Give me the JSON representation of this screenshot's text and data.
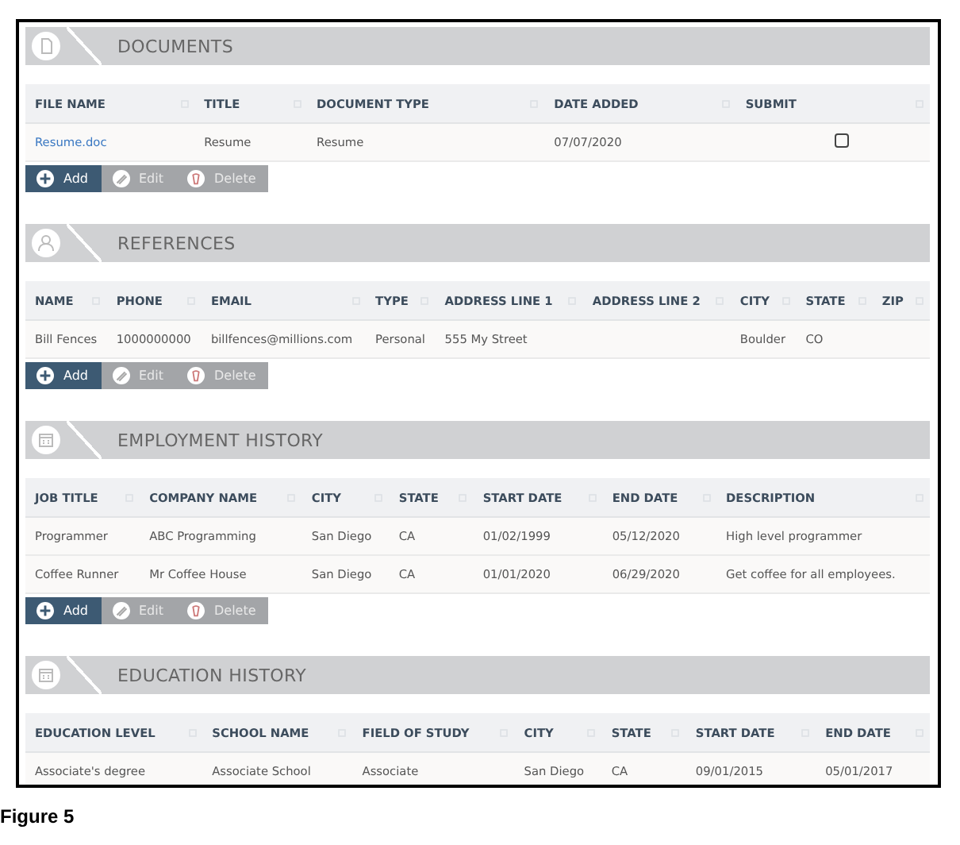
{
  "sections": [
    {
      "title": "DOCUMENTS",
      "columns": [
        "FILE NAME",
        "TITLE",
        "DOCUMENT TYPE",
        "DATE ADDED",
        "SUBMIT"
      ],
      "rows": [
        [
          {
            "kind": "link",
            "text": "Resume.doc"
          },
          {
            "kind": "text",
            "text": "Resume"
          },
          {
            "kind": "text",
            "text": "Resume"
          },
          {
            "kind": "text",
            "text": "07/07/2020"
          },
          {
            "kind": "checkbox",
            "checked": false
          }
        ]
      ],
      "buttons": [
        {
          "label": "Add",
          "disabled": false
        },
        {
          "label": "Edit",
          "disabled": true
        },
        {
          "label": "Delete",
          "disabled": true
        }
      ]
    },
    {
      "title": "REFERENCES",
      "columns": [
        "NAME",
        "PHONE",
        "EMAIL",
        "TYPE",
        "ADDRESS LINE 1",
        "ADDRESS LINE 2",
        "CITY",
        "STATE",
        "ZIP"
      ],
      "rows": [
        [
          {
            "kind": "text",
            "text": "Bill Fences"
          },
          {
            "kind": "text",
            "text": "1000000000"
          },
          {
            "kind": "text",
            "text": "billfences@millions.com"
          },
          {
            "kind": "text",
            "text": "Personal"
          },
          {
            "kind": "text",
            "text": "555 My Street"
          },
          {
            "kind": "text",
            "text": ""
          },
          {
            "kind": "text",
            "text": "Boulder"
          },
          {
            "kind": "text",
            "text": "CO"
          },
          {
            "kind": "text",
            "text": ""
          }
        ]
      ],
      "buttons": [
        {
          "label": "Add",
          "disabled": false
        },
        {
          "label": "Edit",
          "disabled": true
        },
        {
          "label": "Delete",
          "disabled": true
        }
      ]
    },
    {
      "title": "EMPLOYMENT HISTORY",
      "columns": [
        "JOB TITLE",
        "COMPANY NAME",
        "CITY",
        "STATE",
        "START DATE",
        "END DATE",
        "DESCRIPTION"
      ],
      "rows": [
        [
          {
            "kind": "text",
            "text": "Programmer"
          },
          {
            "kind": "text",
            "text": "ABC Programming"
          },
          {
            "kind": "text",
            "text": "San Diego"
          },
          {
            "kind": "text",
            "text": "CA"
          },
          {
            "kind": "text",
            "text": "01/02/1999"
          },
          {
            "kind": "text",
            "text": "05/12/2020"
          },
          {
            "kind": "text",
            "text": "High level programmer"
          }
        ],
        [
          {
            "kind": "text",
            "text": "Coffee Runner"
          },
          {
            "kind": "text",
            "text": "Mr Coffee House"
          },
          {
            "kind": "text",
            "text": "San Diego"
          },
          {
            "kind": "text",
            "text": "CA"
          },
          {
            "kind": "text",
            "text": "01/01/2020"
          },
          {
            "kind": "text",
            "text": "06/29/2020"
          },
          {
            "kind": "text",
            "text": "Get coffee for all employees."
          }
        ]
      ],
      "buttons": [
        {
          "label": "Add",
          "disabled": false
        },
        {
          "label": "Edit",
          "disabled": true
        },
        {
          "label": "Delete",
          "disabled": true
        }
      ]
    },
    {
      "title": "EDUCATION HISTORY",
      "columns": [
        "EDUCATION LEVEL",
        "SCHOOL NAME",
        "FIELD OF STUDY",
        "CITY",
        "STATE",
        "START DATE",
        "END DATE"
      ],
      "rows": [
        [
          {
            "kind": "text",
            "text": "Associate's degree"
          },
          {
            "kind": "text",
            "text": "Associate School"
          },
          {
            "kind": "text",
            "text": "Associate"
          },
          {
            "kind": "text",
            "text": "San Diego"
          },
          {
            "kind": "text",
            "text": "CA"
          },
          {
            "kind": "text",
            "text": "09/01/2015"
          },
          {
            "kind": "text",
            "text": "05/01/2017"
          }
        ]
      ]
    }
  ],
  "caption": "Figure 5"
}
